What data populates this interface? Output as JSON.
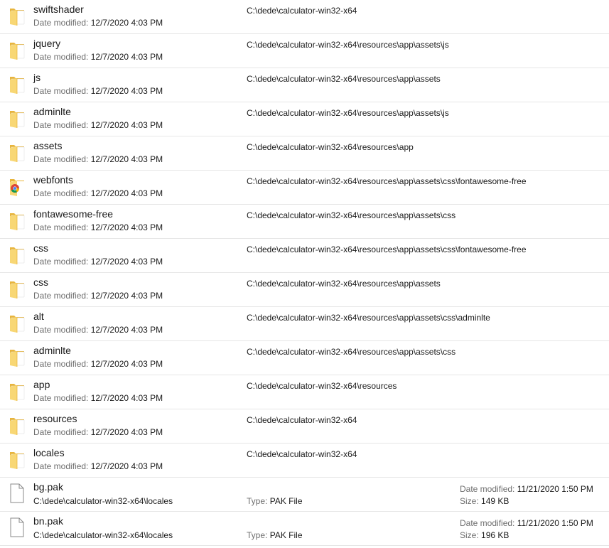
{
  "labels": {
    "date_modified": "Date modified:",
    "type": "Type:",
    "size": "Size:"
  },
  "folders": [
    {
      "name": "swiftshader",
      "date": "12/7/2020 4:03 PM",
      "path": "C:\\dede\\calculator-win32-x64",
      "icon": "folder-icon"
    },
    {
      "name": "jquery",
      "date": "12/7/2020 4:03 PM",
      "path": "C:\\dede\\calculator-win32-x64\\resources\\app\\assets\\js",
      "icon": "folder-icon"
    },
    {
      "name": "js",
      "date": "12/7/2020 4:03 PM",
      "path": "C:\\dede\\calculator-win32-x64\\resources\\app\\assets",
      "icon": "folder-icon"
    },
    {
      "name": "adminlte",
      "date": "12/7/2020 4:03 PM",
      "path": "C:\\dede\\calculator-win32-x64\\resources\\app\\assets\\js",
      "icon": "folder-icon"
    },
    {
      "name": "assets",
      "date": "12/7/2020 4:03 PM",
      "path": "C:\\dede\\calculator-win32-x64\\resources\\app",
      "icon": "folder-icon"
    },
    {
      "name": "webfonts",
      "date": "12/7/2020 4:03 PM",
      "path": "C:\\dede\\calculator-win32-x64\\resources\\app\\assets\\css\\fontawesome-free",
      "icon": "chrome-folder-icon"
    },
    {
      "name": "fontawesome-free",
      "date": "12/7/2020 4:03 PM",
      "path": "C:\\dede\\calculator-win32-x64\\resources\\app\\assets\\css",
      "icon": "folder-icon"
    },
    {
      "name": "css",
      "date": "12/7/2020 4:03 PM",
      "path": "C:\\dede\\calculator-win32-x64\\resources\\app\\assets\\css\\fontawesome-free",
      "icon": "folder-icon"
    },
    {
      "name": "css",
      "date": "12/7/2020 4:03 PM",
      "path": "C:\\dede\\calculator-win32-x64\\resources\\app\\assets",
      "icon": "folder-icon"
    },
    {
      "name": "alt",
      "date": "12/7/2020 4:03 PM",
      "path": "C:\\dede\\calculator-win32-x64\\resources\\app\\assets\\css\\adminlte",
      "icon": "folder-icon"
    },
    {
      "name": "adminlte",
      "date": "12/7/2020 4:03 PM",
      "path": "C:\\dede\\calculator-win32-x64\\resources\\app\\assets\\css",
      "icon": "folder-icon"
    },
    {
      "name": "app",
      "date": "12/7/2020 4:03 PM",
      "path": "C:\\dede\\calculator-win32-x64\\resources",
      "icon": "folder-icon"
    },
    {
      "name": "resources",
      "date": "12/7/2020 4:03 PM",
      "path": "C:\\dede\\calculator-win32-x64",
      "icon": "folder-icon"
    },
    {
      "name": "locales",
      "date": "12/7/2020 4:03 PM",
      "path": "C:\\dede\\calculator-win32-x64",
      "icon": "folder-icon"
    }
  ],
  "files": [
    {
      "name": "bg.pak",
      "path": "C:\\dede\\calculator-win32-x64\\locales",
      "type": "PAK File",
      "date": "11/21/2020 1:50 PM",
      "size": "149 KB",
      "icon": "file-icon"
    },
    {
      "name": "bn.pak",
      "path": "C:\\dede\\calculator-win32-x64\\locales",
      "type": "PAK File",
      "date": "11/21/2020 1:50 PM",
      "size": "196 KB",
      "icon": "file-icon"
    }
  ],
  "colors": {
    "folder": "#f8d775",
    "folder_dark": "#e8b53d",
    "label": "#6d6d6d",
    "divider": "#e6e6e6"
  }
}
